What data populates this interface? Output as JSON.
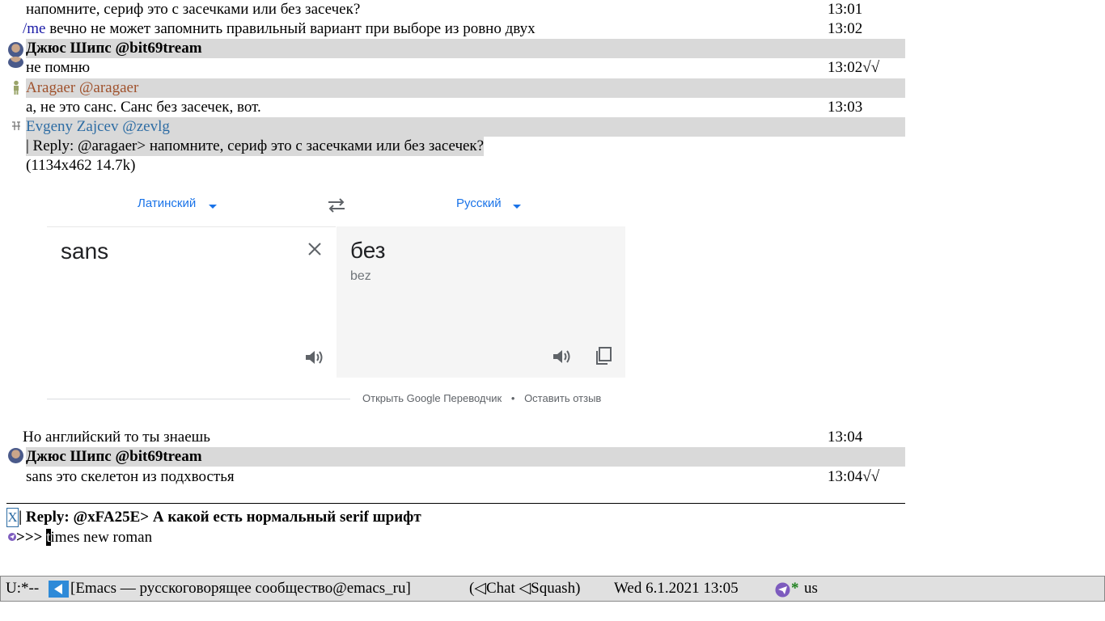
{
  "messages": {
    "m1_text": "напомните, сериф это с засечками или без засечек?",
    "m1_time": "13:01",
    "m2_me": "/me",
    "m2_text": " вечно не может запомнить правильный вариант при выборе из ровно двух",
    "m2_time": "13:02",
    "h1_author": "Джюс Шипс @bit69tream",
    "m3_text": "не помню",
    "m3_time": "13:02√√",
    "h2_author": "Aragaer @aragaer",
    "m4_text": "а, не это санс. Санс без засечек, вот.",
    "m4_time": "13:03",
    "h3_author": "Evgeny Zajcev @zevlg",
    "reply_quote": "| Reply: @aragaer> напомните, сериф это с засечками или без засечек?",
    "image_meta": "(1134x462 14.7k)",
    "m5_text": "Но английский то ты знаешь",
    "m5_time": "13:04",
    "h4_author": "Джюс Шипс @bit69tream",
    "m6_text": "sans это скелетон из подхвостья",
    "m6_time": "13:04√√"
  },
  "translate": {
    "source_lang": "Латинский",
    "target_lang": "Русский",
    "source_text": "sans",
    "target_text": "без",
    "transliteration": "bez",
    "open_link": "Открыть Google Переводчик",
    "dot": "•",
    "feedback_link": "Оставить отзыв"
  },
  "compose": {
    "cancel_mark": "X",
    "reply_header": "| Reply: @xFA25E> А какой есть нормальный serif шрифт",
    "prompt": ">>>",
    "input_first_char": "t",
    "input_rest": "imes new roman"
  },
  "status": {
    "mode": "U:*--",
    "buffer": "[Emacs — русскоговорящее сообщество@emacs_ru]",
    "modes": "(◁Chat ◁Squash)",
    "datetime": "Wed  6.1.2021 13:05",
    "star": "*",
    "layout": "us"
  },
  "colors": {
    "header_bg": "#d9d9d9",
    "me_color": "#1a1aa6",
    "aragaer_color": "#a0522d",
    "evgeny_color": "#2e6da4",
    "google_blue": "#1a73e8",
    "telegram_icon": "#7d5bbe",
    "status_bg": "#e0e0e0"
  },
  "icons": {
    "back": "back-arrow-icon",
    "swap": "swap-arrows-icon",
    "clear": "close-icon",
    "speaker": "speaker-icon",
    "copy": "copy-icon",
    "telegram": "telegram-icon"
  }
}
